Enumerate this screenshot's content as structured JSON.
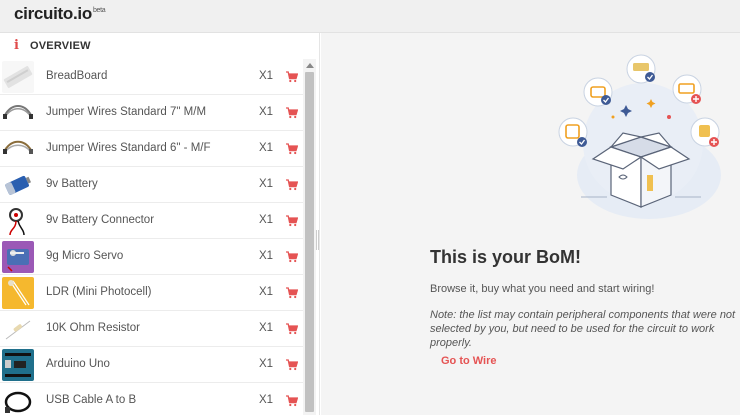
{
  "header": {
    "logo": "circuito.io",
    "logo_sup": "beta"
  },
  "sidebar": {
    "section_title": "OVERVIEW",
    "items": [
      {
        "name": "BreadBoard",
        "qty": "X1",
        "icon": "breadboard-icon"
      },
      {
        "name": "Jumper Wires Standard 7\" M/M",
        "qty": "X1",
        "icon": "jumper-wires-icon"
      },
      {
        "name": "Jumper Wires Standard 6\" - M/F",
        "qty": "X1",
        "icon": "jumper-wires-icon"
      },
      {
        "name": "9v Battery",
        "qty": "X1",
        "icon": "battery-icon"
      },
      {
        "name": "9v Battery Connector",
        "qty": "X1",
        "icon": "battery-connector-icon"
      },
      {
        "name": "9g Micro Servo",
        "qty": "X1",
        "icon": "servo-icon"
      },
      {
        "name": "LDR (Mini Photocell)",
        "qty": "X1",
        "icon": "ldr-icon"
      },
      {
        "name": "10K Ohm Resistor",
        "qty": "X1",
        "icon": "resistor-icon"
      },
      {
        "name": "Arduino Uno",
        "qty": "X1",
        "icon": "arduino-icon"
      },
      {
        "name": "USB Cable A to B",
        "qty": "X1",
        "icon": "usb-cable-icon"
      }
    ]
  },
  "main": {
    "title": "This is your BoM!",
    "subtitle": "Browse it, buy what you need and start wiring!",
    "note": "Note: the list may contain peripheral components that were not selected by you, but need to be used for the circuit to work properly.",
    "cta": "Go to Wire"
  },
  "colors": {
    "accent": "#e55353",
    "check": "#3e5a95",
    "header_bg": "#f0f0f0",
    "panel_bg": "#f4f4f4"
  }
}
